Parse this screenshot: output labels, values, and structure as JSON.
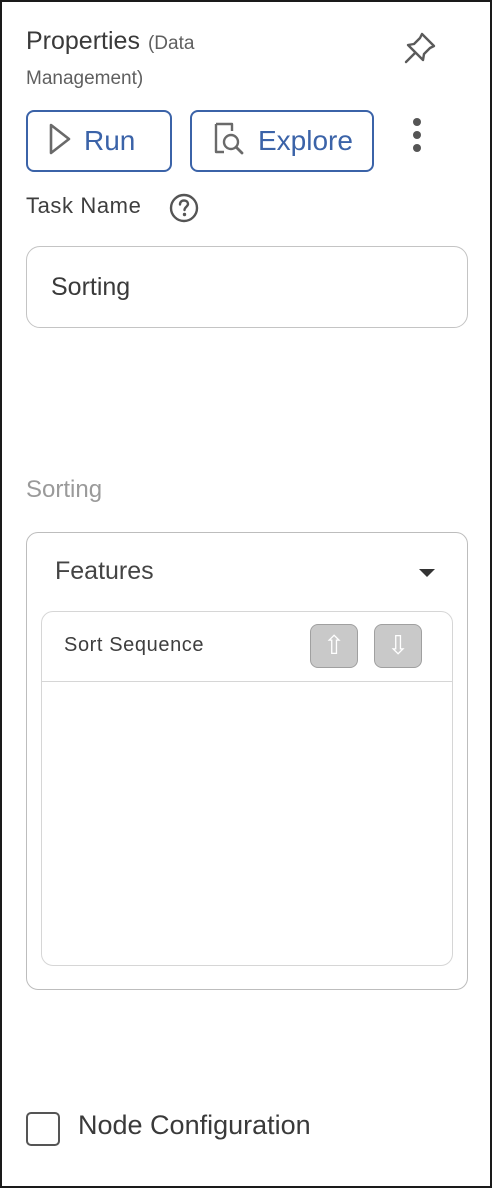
{
  "header": {
    "title": "Properties",
    "subtitle_line1": "(Data",
    "subtitle_line2": "Management)",
    "pin_icon": "pin-icon"
  },
  "actions": {
    "run_label": "Run",
    "run_icon": "play-icon",
    "explore_label": "Explore",
    "explore_icon": "document-search-icon",
    "more_icon": "kebab-menu-icon"
  },
  "task": {
    "label": "Task Name",
    "help_icon": "help-circle-icon",
    "value": "Sorting"
  },
  "section": {
    "label": "Sorting"
  },
  "features": {
    "header": "Features",
    "dropdown_icon": "caret-down-icon",
    "list_header": "Sort Sequence",
    "up_glyph": "⇧",
    "down_glyph": "⇩",
    "items": []
  },
  "node_config": {
    "label": "Node Configuration",
    "checked": false
  },
  "colors": {
    "accent": "#3b63a8",
    "muted_label": "#9a9a9a",
    "disabled_button": "#c9c9c9"
  }
}
